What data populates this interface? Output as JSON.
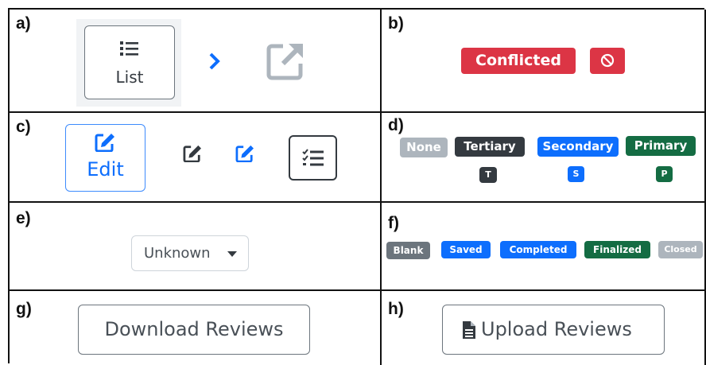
{
  "panels": {
    "a": {
      "label": "a)",
      "list_button": "List"
    },
    "b": {
      "label": "b)",
      "status": "Conflicted"
    },
    "c": {
      "label": "c)",
      "edit_button": "Edit"
    },
    "d": {
      "label": "d)",
      "badges": [
        "None",
        "Tertiary",
        "Secondary",
        "Primary"
      ],
      "short_badges": [
        "T",
        "S",
        "P"
      ]
    },
    "e": {
      "label": "e)",
      "dropdown_value": "Unknown"
    },
    "f": {
      "label": "f)",
      "badges": [
        "Blank",
        "Saved",
        "Completed",
        "Finalized",
        "Closed"
      ]
    },
    "g": {
      "label": "g)",
      "button": "Download Reviews"
    },
    "h": {
      "label": "h)",
      "button": "Upload Reviews"
    }
  },
  "colors": {
    "danger": "#dc3545",
    "secondary": "#6c757d",
    "dark": "#343a40",
    "primary": "#0d6efd",
    "success": "#146c43",
    "muted": "#adb5bd"
  }
}
